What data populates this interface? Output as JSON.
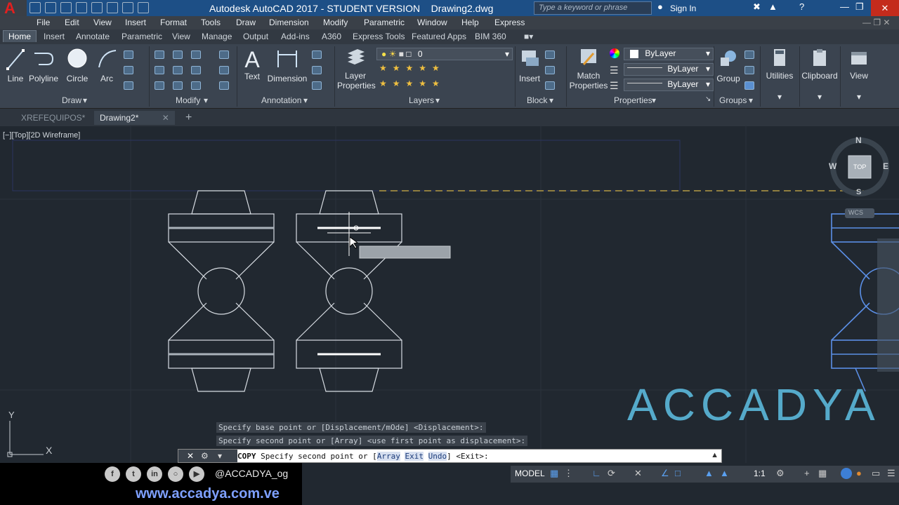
{
  "app": {
    "logo": "A",
    "title": "Autodesk AutoCAD 2017 - STUDENT VERSION    Drawing2.dwg"
  },
  "search": {
    "placeholder": "Type a keyword or phrase"
  },
  "account": {
    "signin": "Sign In"
  },
  "menu": [
    "File",
    "Edit",
    "View",
    "Insert",
    "Format",
    "Tools",
    "Draw",
    "Dimension",
    "Modify",
    "Parametric",
    "Window",
    "Help",
    "Express"
  ],
  "ribbon_tabs": [
    "Home",
    "Insert",
    "Annotate",
    "Parametric",
    "View",
    "Manage",
    "Output",
    "Add-ins",
    "A360",
    "Express Tools",
    "Featured Apps",
    "BIM 360"
  ],
  "draw_panel": {
    "line": "Line",
    "polyline": "Polyline",
    "circle": "Circle",
    "arc": "Arc",
    "label": "Draw"
  },
  "modify_panel": {
    "label": "Modify"
  },
  "annotation_panel": {
    "text": "Text",
    "dimension": "Dimension",
    "label": "Annotation"
  },
  "layers_panel": {
    "layer_properties_1": "Layer",
    "layer_properties_2": "Properties",
    "current_layer": "0",
    "label": "Layers"
  },
  "block_panel": {
    "insert": "Insert",
    "label": "Block"
  },
  "properties_panel": {
    "match_1": "Match",
    "match_2": "Properties",
    "color": "ByLayer",
    "linetype": "ByLayer",
    "lineweight": "ByLayer",
    "label": "Properties"
  },
  "groups_panel": {
    "group": "Group",
    "label": "Groups"
  },
  "utilities": "Utilities",
  "clipboard": "Clipboard",
  "view_btn": "View",
  "file_tabs": [
    "XREFEQUIPOS*",
    "Drawing2*"
  ],
  "viewport": {
    "label": "[−][Top][2D Wireframe]"
  },
  "viewcube": {
    "n": "N",
    "s": "S",
    "e": "E",
    "w": "W",
    "top": "TOP",
    "wcs": "WCS"
  },
  "ucs": {
    "x": "X",
    "y": "Y"
  },
  "command": {
    "history": [
      "Specify base point or [Displacement/mOde] <Displacement>:",
      "Specify second point or [Array] <use first point as displacement>:"
    ],
    "name": "COPY",
    "prompt": "Specify second point or [",
    "opt1": "Array",
    "opt2": "Exit",
    "opt3": "Undo",
    "suffix": "] <Exit>:"
  },
  "status": {
    "model": "MODEL",
    "scale": "1:1"
  },
  "branding": {
    "handle": "@ACCADYA_og",
    "website": "www.accadya.com.ve",
    "watermark": "ACCADYA"
  },
  "colors": {
    "title_bar": "#1d4f86",
    "viewport": "#212830",
    "ribbon": "#3b4450",
    "watermark": "#5fc1e6"
  }
}
